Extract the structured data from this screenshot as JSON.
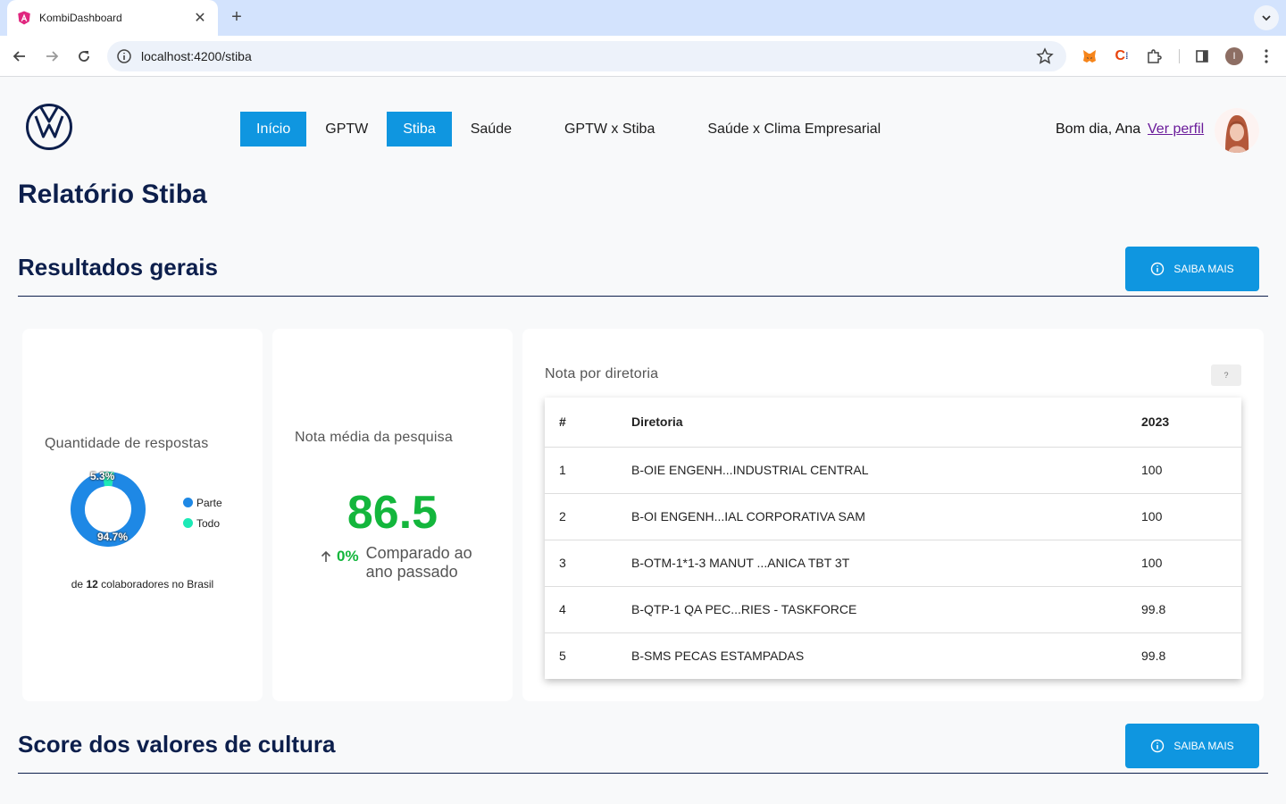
{
  "browser": {
    "tab_title": "KombiDashboard",
    "url": "localhost:4200/stiba",
    "profile_initial": "I"
  },
  "header": {
    "nav": [
      {
        "label": "Início",
        "active": true
      },
      {
        "label": "GPTW",
        "active": false
      },
      {
        "label": "Stiba",
        "active": true
      },
      {
        "label": "Saúde",
        "active": false
      },
      {
        "label": "GPTW x Stiba",
        "active": false
      },
      {
        "label": "Saúde x Clima Empresarial",
        "active": false
      }
    ],
    "greeting": "Bom dia, Ana",
    "profile_link": "Ver perfil"
  },
  "page": {
    "title": "Relatório Stiba"
  },
  "sections": {
    "general": {
      "title": "Resultados gerais",
      "button": "SAIBA MAIS"
    },
    "culture": {
      "title": "Score dos valores de cultura",
      "button": "SAIBA MAIS"
    }
  },
  "responses_card": {
    "label": "Quantidade de respostas",
    "legend": [
      {
        "name": "Parte",
        "color": "#1e88e5"
      },
      {
        "name": "Todo",
        "color": "#1de9b6"
      }
    ],
    "slices": [
      {
        "name": "Parte",
        "value": 94.7,
        "label": "94.7%"
      },
      {
        "name": "Todo",
        "value": 5.3,
        "label": "5.3%"
      }
    ],
    "total_prefix": "de",
    "total_count": "12",
    "total_suffix": "colaboradores no Brasil"
  },
  "score_card": {
    "label": "Nota média da pesquisa",
    "value": "86.5",
    "change": "0%",
    "change_text": "Comparado ao ano passado"
  },
  "directorate_card": {
    "label": "Nota por diretoria",
    "help": "?",
    "columns": [
      "#",
      "Diretoria",
      "2023"
    ],
    "rows": [
      {
        "rank": "1",
        "name": "B-OIE ENGENH...INDUSTRIAL CENTRAL",
        "score": "100"
      },
      {
        "rank": "2",
        "name": "B-OI ENGENH...IAL CORPORATIVA SAM",
        "score": "100"
      },
      {
        "rank": "3",
        "name": "B-OTM-1*1-3 MANUT ...ANICA TBT 3T",
        "score": "100"
      },
      {
        "rank": "4",
        "name": "B-QTP-1 QA PEC...RIES - TASKFORCE",
        "score": "99.8"
      },
      {
        "rank": "5",
        "name": "B-SMS PECAS ESTAMPADAS",
        "score": "99.8"
      }
    ]
  },
  "colors": {
    "primary": "#0f96e0",
    "navy": "#0d1f4c",
    "positive": "#13b63c"
  }
}
